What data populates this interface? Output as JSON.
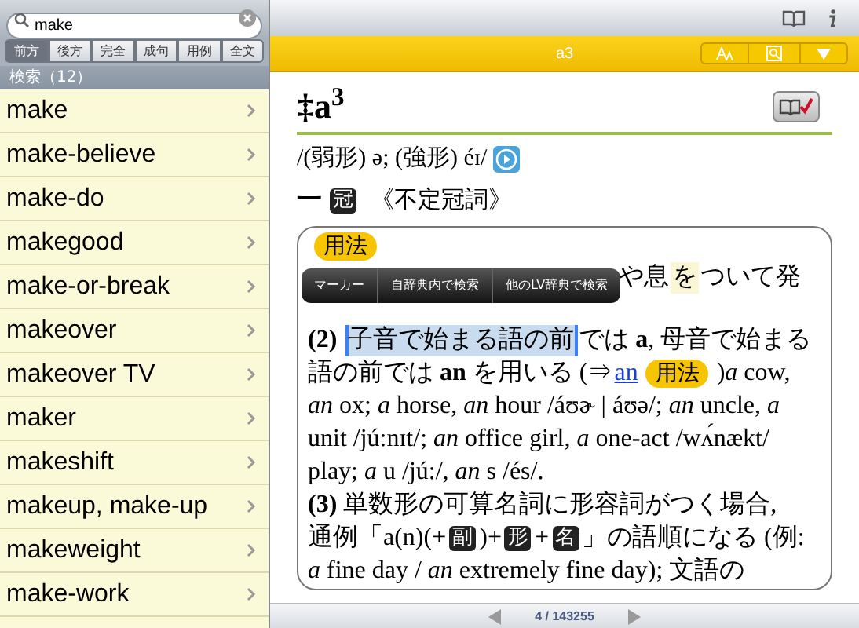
{
  "search": {
    "value": "make"
  },
  "filters": [
    {
      "label": "前方",
      "selected": true
    },
    {
      "label": "後方",
      "selected": false
    },
    {
      "label": "完全",
      "selected": false
    },
    {
      "label": "成句",
      "selected": false
    },
    {
      "label": "用例",
      "selected": false
    },
    {
      "label": "全文",
      "selected": false
    }
  ],
  "results_header": "検索（12）",
  "results": [
    "make",
    "make-believe",
    "make-do",
    "makegood",
    "make-or-break",
    "makeover",
    "makeover TV",
    "maker",
    "makeshift",
    "makeup, make-up",
    "makeweight",
    "make-work"
  ],
  "entry_bar": {
    "title": "a3"
  },
  "entry": {
    "headword": "‡a$^{3}$",
    "pronunciation": "/(弱形) ə; (強形) éɪ/",
    "part_of_speech": {
      "prefix": "一",
      "tag": "冠",
      "label": "《不定冠詞》"
    },
    "usage_box": {
      "badge": "用法",
      "lines": [
        [
          {
            "kind": "text",
            "text": "や息"
          },
          {
            "kind": "marker",
            "text": "を",
            "color": "#fbf7d6"
          },
          {
            "kind": "text",
            "text": "ついて発"
          }
        ],
        [
          {
            "kind": "text",
            "text": "**(2)**"
          },
          {
            "kind": "selected",
            "text": "子音で始まる語の前"
          },
          {
            "kind": "text",
            "text": "では **a**, 母音で始まる"
          }
        ],
        [
          {
            "kind": "text",
            "text": "語の前では **an** を用いる (⇒"
          },
          {
            "kind": "link",
            "text": "an"
          },
          {
            "kind": "badge",
            "text": "用法"
          },
          {
            "kind": "text",
            "text": ")*a* cow,"
          }
        ],
        [
          {
            "kind": "text",
            "text": "*an* ox; *a* horse, *an* hour /áʊɚ | áʊə/; *an* uncle, *a*"
          }
        ],
        [
          {
            "kind": "text",
            "text": "unit /jú:nɪt/; *an* office girl, *a* one-act /wʌ́nækt/"
          }
        ],
        [
          {
            "kind": "text",
            "text": "play; *a* u /jú:/, *an* s /és/."
          }
        ],
        [
          {
            "kind": "text",
            "text": "**(3)** 単数形の可算名詞に形容詞がつく場合,"
          }
        ],
        [
          {
            "kind": "text",
            "text": "通例「a(n)(+"
          },
          {
            "kind": "tag",
            "text": "副"
          },
          {
            "kind": "text",
            "text": ")+"
          },
          {
            "kind": "tag",
            "text": "形"
          },
          {
            "kind": "text",
            "text": "+"
          },
          {
            "kind": "tag",
            "text": "名"
          },
          {
            "kind": "text",
            "text": "」の語順になる (例:"
          }
        ],
        [
          {
            "kind": "text",
            "text": "*a* fine day / *an* extremely fine day); 文語の"
          }
        ]
      ]
    }
  },
  "context_menu": [
    "マーカー",
    "自辞典内で検索",
    "他のLV辞典で検索"
  ],
  "pager": "4 / 143255"
}
